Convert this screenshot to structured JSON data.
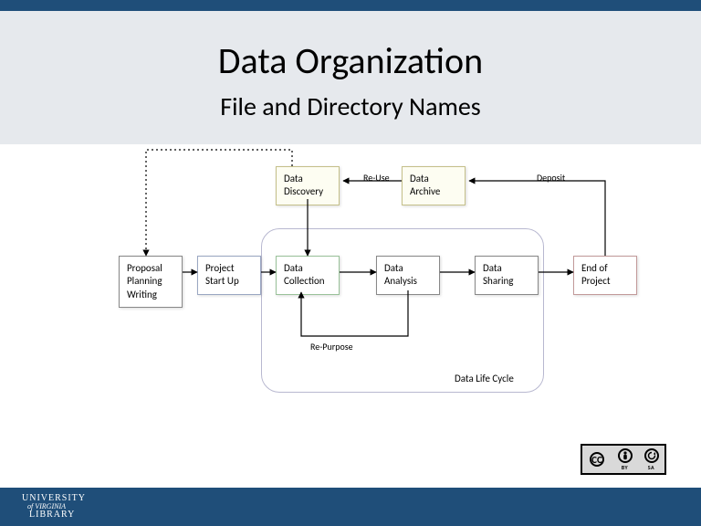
{
  "header": {
    "title": "Data Organization",
    "subtitle": "File and Directory Names"
  },
  "nodes": {
    "proposal": "Proposal\nPlanning\nWriting",
    "startup": "Project\nStart Up",
    "discovery": "Data\nDiscovery",
    "collection": "Data\nCollection",
    "analysis": "Data\nAnalysis",
    "sharing": "Data\nSharing",
    "archive": "Data\nArchive",
    "end": "End of\nProject"
  },
  "edges": {
    "reuse": "Re-Use",
    "repurpose": "Re-Purpose",
    "deposit": "Deposit"
  },
  "group": {
    "lifecycle": "Data Life Cycle"
  },
  "license": {
    "cc": "CC",
    "by": "BY",
    "sa": "SA"
  },
  "footer": {
    "line1": "UNIVERSITY",
    "line2": "of VIRGINIA",
    "line3": "LIBRARY"
  }
}
